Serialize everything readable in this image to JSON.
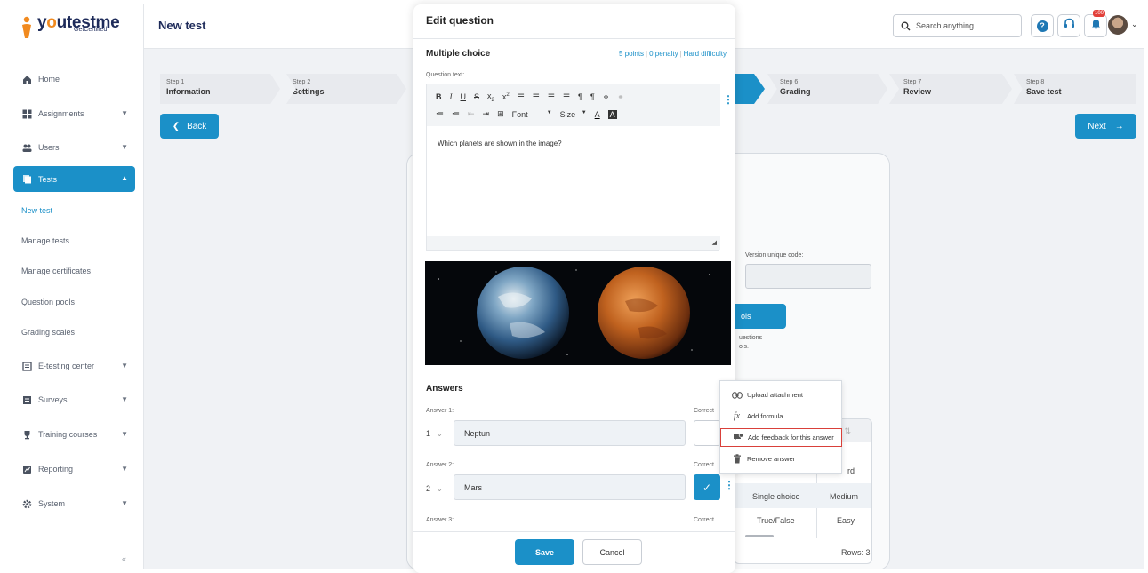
{
  "app": {
    "logo_main_1": "y",
    "logo_o": "o",
    "logo_main_2": "utestme",
    "logo_sub": "GetCertified"
  },
  "sidebar": {
    "items": [
      {
        "label": "Home"
      },
      {
        "label": "Assignments"
      },
      {
        "label": "Users"
      },
      {
        "label": "Tests"
      },
      {
        "label": "E-testing center"
      },
      {
        "label": "Surveys"
      },
      {
        "label": "Training courses"
      },
      {
        "label": "Reporting"
      },
      {
        "label": "System"
      }
    ],
    "tests_sub": [
      "New test",
      "Manage tests",
      "Manage certificates",
      "Question pools",
      "Grading scales"
    ],
    "collapse": "«"
  },
  "header": {
    "title": "New test",
    "search_placeholder": "Search anything",
    "badge": "100"
  },
  "steps": [
    {
      "step": "Step 1",
      "name": "Information"
    },
    {
      "step": "Step 2",
      "name": "Settings"
    },
    {
      "step": "Step 6",
      "name": "Grading"
    },
    {
      "step": "Step 7",
      "name": "Review"
    },
    {
      "step": "Step 8",
      "name": "Save test"
    }
  ],
  "nav_buttons": {
    "back": "Back",
    "next": "Next"
  },
  "background": {
    "vuc_label": "Version unique code:",
    "pools_btn": "ols",
    "qtext_1": "uestions",
    "qtext_2": "ols.",
    "table": {
      "header_partial": "lty",
      "r1_diff": "rd",
      "r2_type": "Single choice",
      "r2_diff": "Medium",
      "r3_type": "True/False",
      "r3_diff": "Easy",
      "rows": "Rows: 3"
    }
  },
  "modal": {
    "title": "Edit question",
    "type": "Multiple choice",
    "points": "5 points",
    "penalty": "0 penalty",
    "difficulty": "Hard difficulty",
    "question_label": "Question text:",
    "question_text": "Which planets are shown in the image?",
    "toolbar": {
      "font": "Font",
      "size": "Size"
    },
    "answers_title": "Answers",
    "answers": [
      {
        "label": "Answer 1:",
        "num": "1",
        "value": "Neptun",
        "correct": false
      },
      {
        "label": "Answer 2:",
        "num": "2",
        "value": "Mars",
        "correct": true
      },
      {
        "label": "Answer 3:"
      }
    ],
    "correct_label": "Correct",
    "save": "Save",
    "cancel": "Cancel"
  },
  "menu": {
    "items": [
      {
        "label": "Upload attachment",
        "icon": "link-icon"
      },
      {
        "label": "Add formula",
        "icon": "formula-icon"
      },
      {
        "label": "Add feedback for this answer",
        "icon": "feedback-icon"
      },
      {
        "label": "Remove answer",
        "icon": "trash-icon"
      }
    ]
  },
  "colors": {
    "primary": "#1b90c8",
    "brand_navy": "#1e2b5a",
    "brand_orange": "#f18a1f",
    "highlight": "#d9403a"
  }
}
